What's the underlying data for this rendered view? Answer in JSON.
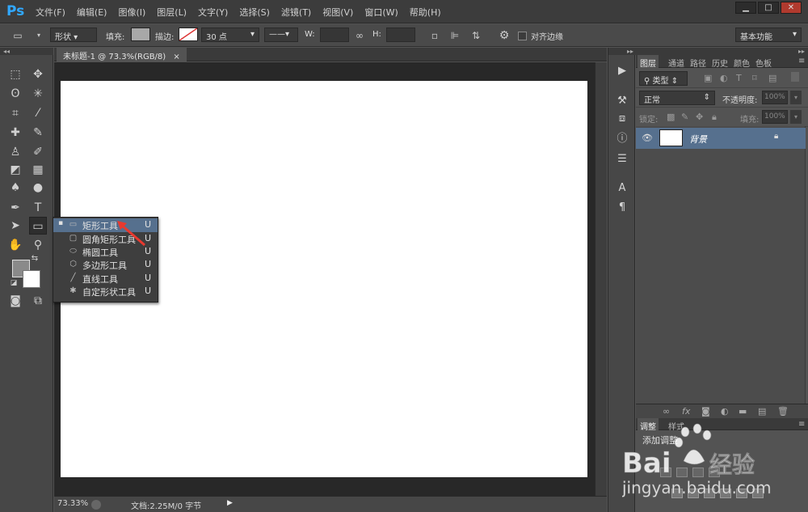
{
  "app": {
    "logo": "Ps"
  },
  "menu": [
    "文件(F)",
    "编辑(E)",
    "图像(I)",
    "图层(L)",
    "文字(Y)",
    "选择(S)",
    "滤镜(T)",
    "视图(V)",
    "窗口(W)",
    "帮助(H)"
  ],
  "options": {
    "mode": "形状",
    "fill_label": "填充:",
    "stroke_label": "描边:",
    "stroke_size": "30 点",
    "w_label": "W:",
    "h_label": "H:",
    "align_edges": "对齐边缘",
    "workspace": "基本功能"
  },
  "document": {
    "tab_title": "未标题-1 @ 73.3%(RGB/8)",
    "close": "×"
  },
  "status": {
    "zoom": "73.33%",
    "doc_size": "文档:2.25M/0 字节"
  },
  "flyout": [
    {
      "name": "矩形工具",
      "key": "U",
      "selected": true
    },
    {
      "name": "圆角矩形工具",
      "key": "U"
    },
    {
      "name": "椭圆工具",
      "key": "U"
    },
    {
      "name": "多边形工具",
      "key": "U"
    },
    {
      "name": "直线工具",
      "key": "U"
    },
    {
      "name": "自定形状工具",
      "key": "U"
    }
  ],
  "layers_panel": {
    "tabs": [
      "图层",
      "通道",
      "路径",
      "历史",
      "颜色",
      "色板"
    ],
    "filter": "类型",
    "blend_mode": "正常",
    "opacity_label": "不透明度:",
    "opacity": "100%",
    "lock_label": "锁定:",
    "fill_label": "填充:",
    "fill": "100%",
    "layer_name": "背景"
  },
  "adjust_panel": {
    "tabs": [
      "调整",
      "样式"
    ],
    "title": "添加调整"
  },
  "colors": {
    "accent": "#56708e",
    "ps_blue": "#31a8ff",
    "arrow": "#e8392f"
  }
}
